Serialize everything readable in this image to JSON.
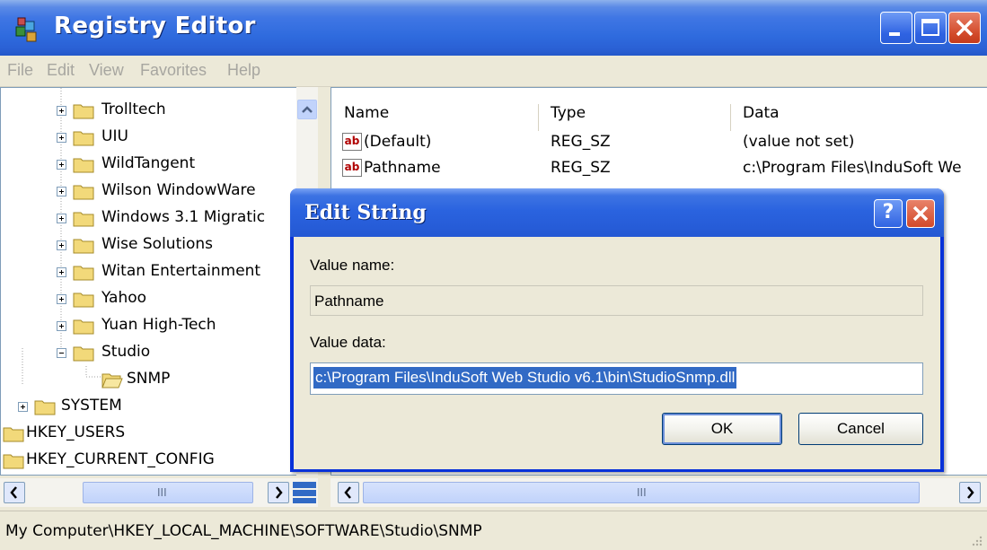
{
  "window": {
    "title": "Registry Editor",
    "controls": [
      "minimize",
      "maximize",
      "close"
    ]
  },
  "menu": [
    "File",
    "Edit",
    "View",
    "Favorites",
    "Help"
  ],
  "tree": {
    "items": [
      {
        "label": "Trolltech",
        "expander": "plus"
      },
      {
        "label": "UIU",
        "expander": "plus"
      },
      {
        "label": "WildTangent",
        "expander": "plus"
      },
      {
        "label": "Wilson WindowWare",
        "expander": "plus"
      },
      {
        "label": "Windows 3.1 Migratic",
        "expander": "plus"
      },
      {
        "label": "Wise Solutions",
        "expander": "plus"
      },
      {
        "label": "Witan Entertainment",
        "expander": "plus"
      },
      {
        "label": "Yahoo",
        "expander": "plus"
      },
      {
        "label": "Yuan High-Tech",
        "expander": "plus"
      },
      {
        "label": "Studio",
        "expander": "minus"
      },
      {
        "label": "SNMP",
        "expander": "none"
      },
      {
        "label": "SYSTEM",
        "expander": "plus"
      },
      {
        "label": "HKEY_USERS",
        "expander": "none"
      },
      {
        "label": "HKEY_CURRENT_CONFIG",
        "expander": "none"
      }
    ]
  },
  "list": {
    "columns": [
      "Name",
      "Type",
      "Data"
    ],
    "rows": [
      {
        "name": "(Default)",
        "type": "REG_SZ",
        "data": "(value not set)"
      },
      {
        "name": "Pathname",
        "type": "REG_SZ",
        "data": "c:\\Program Files\\InduSoft We"
      }
    ]
  },
  "scrollbar_grip": "III",
  "status": {
    "path": "My Computer\\HKEY_LOCAL_MACHINE\\SOFTWARE\\Studio\\SNMP"
  },
  "dialog": {
    "title": "Edit String",
    "help_label": "?",
    "value_name_label": "Value name:",
    "value_name": "Pathname",
    "value_data_label": "Value data:",
    "value_data": "c:\\Program Files\\InduSoft Web Studio v6.1\\bin\\StudioSnmp.dll",
    "ok_label": "OK",
    "cancel_label": "Cancel"
  },
  "colors": {
    "titlebar": "#2f6bde",
    "selection": "#316ac5",
    "close_button": "#d24a2a"
  }
}
